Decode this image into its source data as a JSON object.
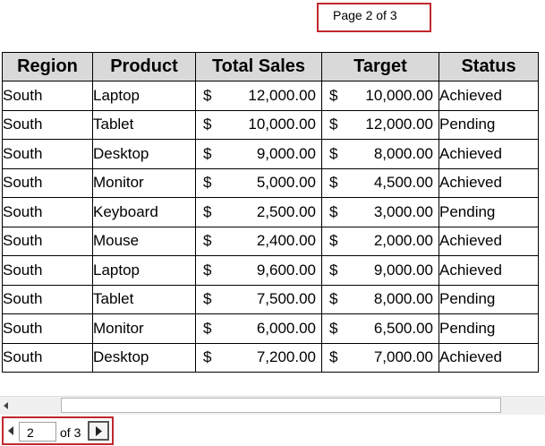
{
  "page_indicator": "Page 2 of 3",
  "table": {
    "headers": [
      "Region",
      "Product",
      "Total Sales",
      "Target",
      "Status"
    ],
    "currency_symbol": "$",
    "rows": [
      {
        "region": "South",
        "product": "Laptop",
        "sales": "12,000.00",
        "target": "10,000.00",
        "status": "Achieved"
      },
      {
        "region": "South",
        "product": "Tablet",
        "sales": "10,000.00",
        "target": "12,000.00",
        "status": "Pending"
      },
      {
        "region": "South",
        "product": "Desktop",
        "sales": "9,000.00",
        "target": "8,000.00",
        "status": "Achieved"
      },
      {
        "region": "South",
        "product": "Monitor",
        "sales": "5,000.00",
        "target": "4,500.00",
        "status": "Achieved"
      },
      {
        "region": "South",
        "product": "Keyboard",
        "sales": "2,500.00",
        "target": "3,000.00",
        "status": "Pending"
      },
      {
        "region": "South",
        "product": "Mouse",
        "sales": "2,400.00",
        "target": "2,000.00",
        "status": "Achieved"
      },
      {
        "region": "South",
        "product": "Laptop",
        "sales": "9,600.00",
        "target": "9,000.00",
        "status": "Achieved"
      },
      {
        "region": "South",
        "product": "Tablet",
        "sales": "7,500.00",
        "target": "8,000.00",
        "status": "Pending"
      },
      {
        "region": "South",
        "product": "Monitor",
        "sales": "6,000.00",
        "target": "6,500.00",
        "status": "Pending"
      },
      {
        "region": "South",
        "product": "Desktop",
        "sales": "7,200.00",
        "target": "7,000.00",
        "status": "Achieved"
      }
    ]
  },
  "pager": {
    "current_page": "2",
    "of_label": "of 3",
    "prev_icon": "triangle-left-icon",
    "next_icon": "triangle-right-icon"
  },
  "scrollbar": {
    "left_icon": "scroll-left-icon"
  },
  "colors": {
    "header_bg": "#d9d9d9",
    "highlight_border": "#c0282d"
  }
}
